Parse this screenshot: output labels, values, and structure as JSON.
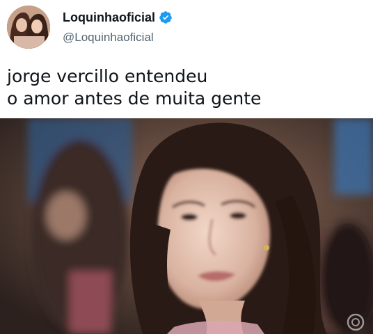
{
  "header": {
    "display_name": "Loquinhaoficial",
    "handle": "@Loquinhaoficial"
  },
  "tweet": {
    "lines": [
      "jorge vercillo entendeu",
      "o amor antes de muita gente"
    ]
  },
  "icons": {
    "verified": "verified-badge-icon"
  },
  "colors": {
    "verified_blue": "#1d9bf0",
    "text_primary": "#0f1419",
    "text_secondary": "#536471"
  }
}
